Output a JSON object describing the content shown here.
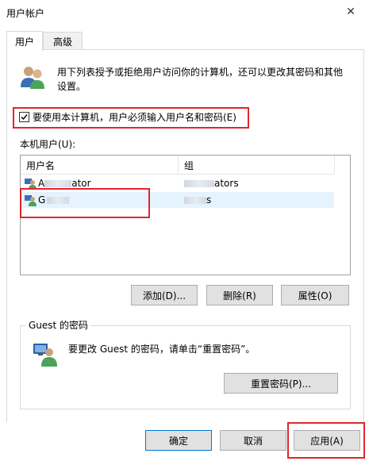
{
  "window": {
    "title": "用户帐户",
    "close_glyph": "✕"
  },
  "tabs": [
    {
      "label": "用户"
    },
    {
      "label": "高级"
    }
  ],
  "intro": {
    "text": "用下列表授予或拒绝用户访问你的计算机，还可以更改其密码和其他设置。"
  },
  "require_login": {
    "label": "要使用本计算机，用户必须输入用户名和密码(E)",
    "checked": true
  },
  "users_label": "本机用户(U):",
  "table": {
    "columns": [
      "用户名",
      "组"
    ],
    "rows": [
      {
        "name_prefix": "A",
        "name_suffix": "ator",
        "group_suffix": "ators"
      },
      {
        "name_prefix": "G",
        "name_suffix": "",
        "group_suffix": "s"
      }
    ]
  },
  "user_buttons": {
    "add": "添加(D)...",
    "remove": "删除(R)",
    "properties": "属性(O)"
  },
  "password_group": {
    "title": "Guest 的密码",
    "text": "要更改 Guest 的密码，请单击“重置密码”。",
    "reset_button": "重置密码(P)..."
  },
  "dialog_buttons": {
    "ok": "确定",
    "cancel": "取消",
    "apply": "应用(A)"
  },
  "colors": {
    "highlight": "#e0262d",
    "selection": "#e5f3ff",
    "button_bg": "#e1e1e1",
    "accent": "#0078d7"
  }
}
